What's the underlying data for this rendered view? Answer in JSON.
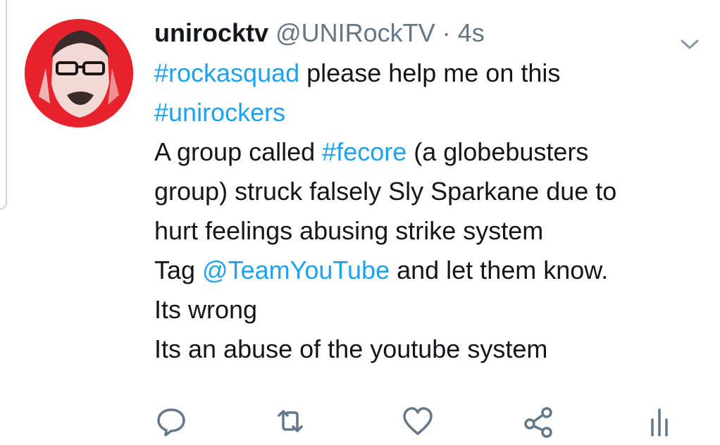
{
  "tweet": {
    "display_name": "unirocktv",
    "handle": "@UNIRockTV",
    "separator": "·",
    "time": "4s",
    "lines": [
      [
        {
          "text": "#rockasquad",
          "kind": "tag"
        },
        {
          "text": " please help me on this",
          "kind": "text"
        }
      ],
      [
        {
          "text": "#unirockers",
          "kind": "tag"
        }
      ],
      [
        {
          "text": "A group called ",
          "kind": "text"
        },
        {
          "text": "#fecore",
          "kind": "tag"
        },
        {
          "text": " (a globebusters",
          "kind": "text"
        }
      ],
      [
        {
          "text": "group) struck falsely Sly Sparkane due to",
          "kind": "text"
        }
      ],
      [
        {
          "text": "hurt feelings abusing strike system",
          "kind": "text"
        }
      ],
      [
        {
          "text": "Tag ",
          "kind": "text"
        },
        {
          "text": "@TeamYouTube",
          "kind": "tag"
        },
        {
          "text": " and let them know.",
          "kind": "text"
        }
      ],
      [
        {
          "text": "Its wrong",
          "kind": "text"
        }
      ],
      [
        {
          "text": "Its an abuse of the youtube system",
          "kind": "text"
        }
      ]
    ]
  },
  "icons": {
    "avatar": "user-avatar",
    "menu": "chevron-down-icon",
    "reply": "reply-icon",
    "retweet": "retweet-icon",
    "like": "heart-icon",
    "share": "share-icon",
    "analytics": "analytics-icon"
  },
  "colors": {
    "link": "#1da1f2",
    "muted": "#657786",
    "text": "#14171a",
    "avatar_bg": "#e6232c"
  }
}
